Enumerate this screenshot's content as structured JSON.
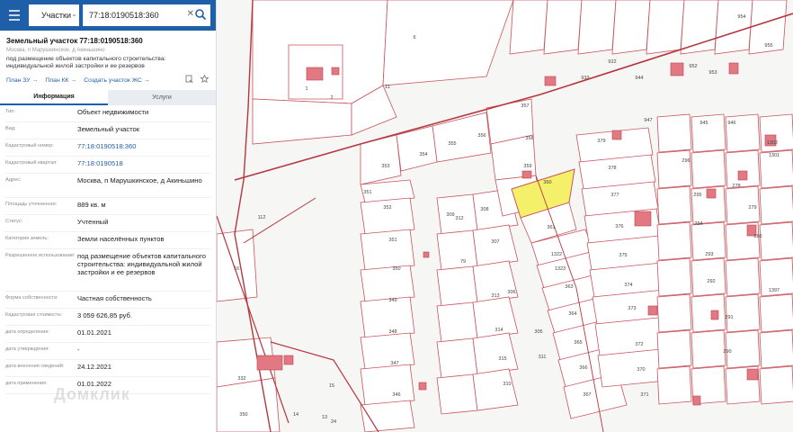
{
  "search": {
    "select_label": "Участки",
    "query": "77:18:0190518:360"
  },
  "object": {
    "title": "Земельный участок 77:18:0190518:360",
    "address_short": "Москва, п Марушкинское, д Акиньшино",
    "description": "под размещение объектов капитального строительства: индивидуальной жилой застройки и ее резервов"
  },
  "links": {
    "plan_zu": "План ЗУ →",
    "plan_kk": "План КК →",
    "create_zhs": "Создать участок ЖС →"
  },
  "tabs": {
    "info": "Информация",
    "services": "Услуги"
  },
  "info": [
    {
      "label": "Тип:",
      "value": "Объект недвижимости"
    },
    {
      "label": "Вид:",
      "value": "Земельный участок"
    },
    {
      "label": "Кадастровый номер:",
      "value": "77:18:0190518:360"
    },
    {
      "label": "Кадастровый квартал:",
      "value": "77:18:0190518"
    },
    {
      "label": "Адрес:",
      "value": "Москва, п Марушкинское, д Акиньшино"
    },
    {
      "label": "Площадь уточненная:",
      "value": "889 кв. м"
    },
    {
      "label": "Статус:",
      "value": "Учтенный"
    },
    {
      "label": "Категория земель:",
      "value": "Земли населённых пунктов"
    },
    {
      "label": "Разрешенное использование:",
      "value": "под размещение объектов капитального строительства: индивидуальной жилой застройки и ее резервов"
    },
    {
      "label": "Форма собственности:",
      "value": "Частная собственность"
    },
    {
      "label": "Кадастровая стоимость:",
      "value": "3 059 626,85 руб."
    },
    {
      "label": "дата определения:",
      "value": "01.01.2021"
    },
    {
      "label": "дата утверждения:",
      "value": "-"
    },
    {
      "label": "дата внесения сведений:",
      "value": "24.12.2021"
    },
    {
      "label": "дата применения:",
      "value": "01.01.2022"
    }
  ],
  "watermark": "Домклик",
  "map": {
    "highlight_color": "#f5f06a",
    "boundary_color": "#c9545c",
    "road_color": "#b5373f",
    "building_color": "#e27881",
    "plot_labels": [
      "6",
      "11",
      "1",
      "2",
      "357",
      "358",
      "356",
      "355",
      "354",
      "353",
      "351",
      "352",
      "351",
      "350",
      "349",
      "348",
      "347",
      "346",
      "359",
      "360",
      "361",
      "1322",
      "1323",
      "363",
      "364",
      "365",
      "366",
      "367",
      "379",
      "378",
      "377",
      "376",
      "375",
      "374",
      "373",
      "372",
      "370",
      "371",
      "922",
      "933",
      "944",
      "947",
      "952",
      "953",
      "954",
      "955",
      "945",
      "946",
      "296",
      "295",
      "294",
      "293",
      "292",
      "291",
      "290",
      "278",
      "279",
      "280",
      "1302",
      "1301",
      "1397",
      "312",
      "313",
      "314",
      "315",
      "310",
      "309",
      "308",
      "307",
      "306",
      "305",
      "311",
      "79",
      "112",
      "16",
      "332",
      "350",
      "13",
      "14",
      "15",
      "24"
    ]
  }
}
